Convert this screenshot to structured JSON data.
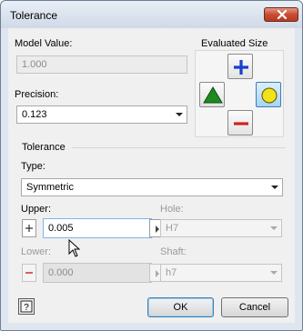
{
  "window": {
    "title": "Tolerance"
  },
  "model_value": {
    "label": "Model Value:",
    "value": "1.000"
  },
  "precision": {
    "label": "Precision:",
    "value": "0.123"
  },
  "evaluated_size": {
    "label": "Evaluated Size",
    "buttons": [
      {
        "name": "upper",
        "icon": "plus-icon",
        "color": "#1a3fcf"
      },
      {
        "name": "nominal",
        "icon": "triangle-icon",
        "color": "#1f8a1f"
      },
      {
        "name": "median",
        "icon": "circle-icon",
        "color": "#f2e21a",
        "active": true
      },
      {
        "name": "lower",
        "icon": "minus-icon",
        "color": "#d22020"
      }
    ]
  },
  "tolerance": {
    "group_label": "Tolerance",
    "type_label": "Type:",
    "type_value": "Symmetric",
    "upper_label": "Upper:",
    "upper_value": "0.005",
    "lower_label": "Lower:",
    "lower_value": "0.000",
    "hole_label": "Hole:",
    "hole_value": "H7",
    "shaft_label": "Shaft:",
    "shaft_value": "h7"
  },
  "buttons": {
    "ok": "OK",
    "cancel": "Cancel"
  }
}
